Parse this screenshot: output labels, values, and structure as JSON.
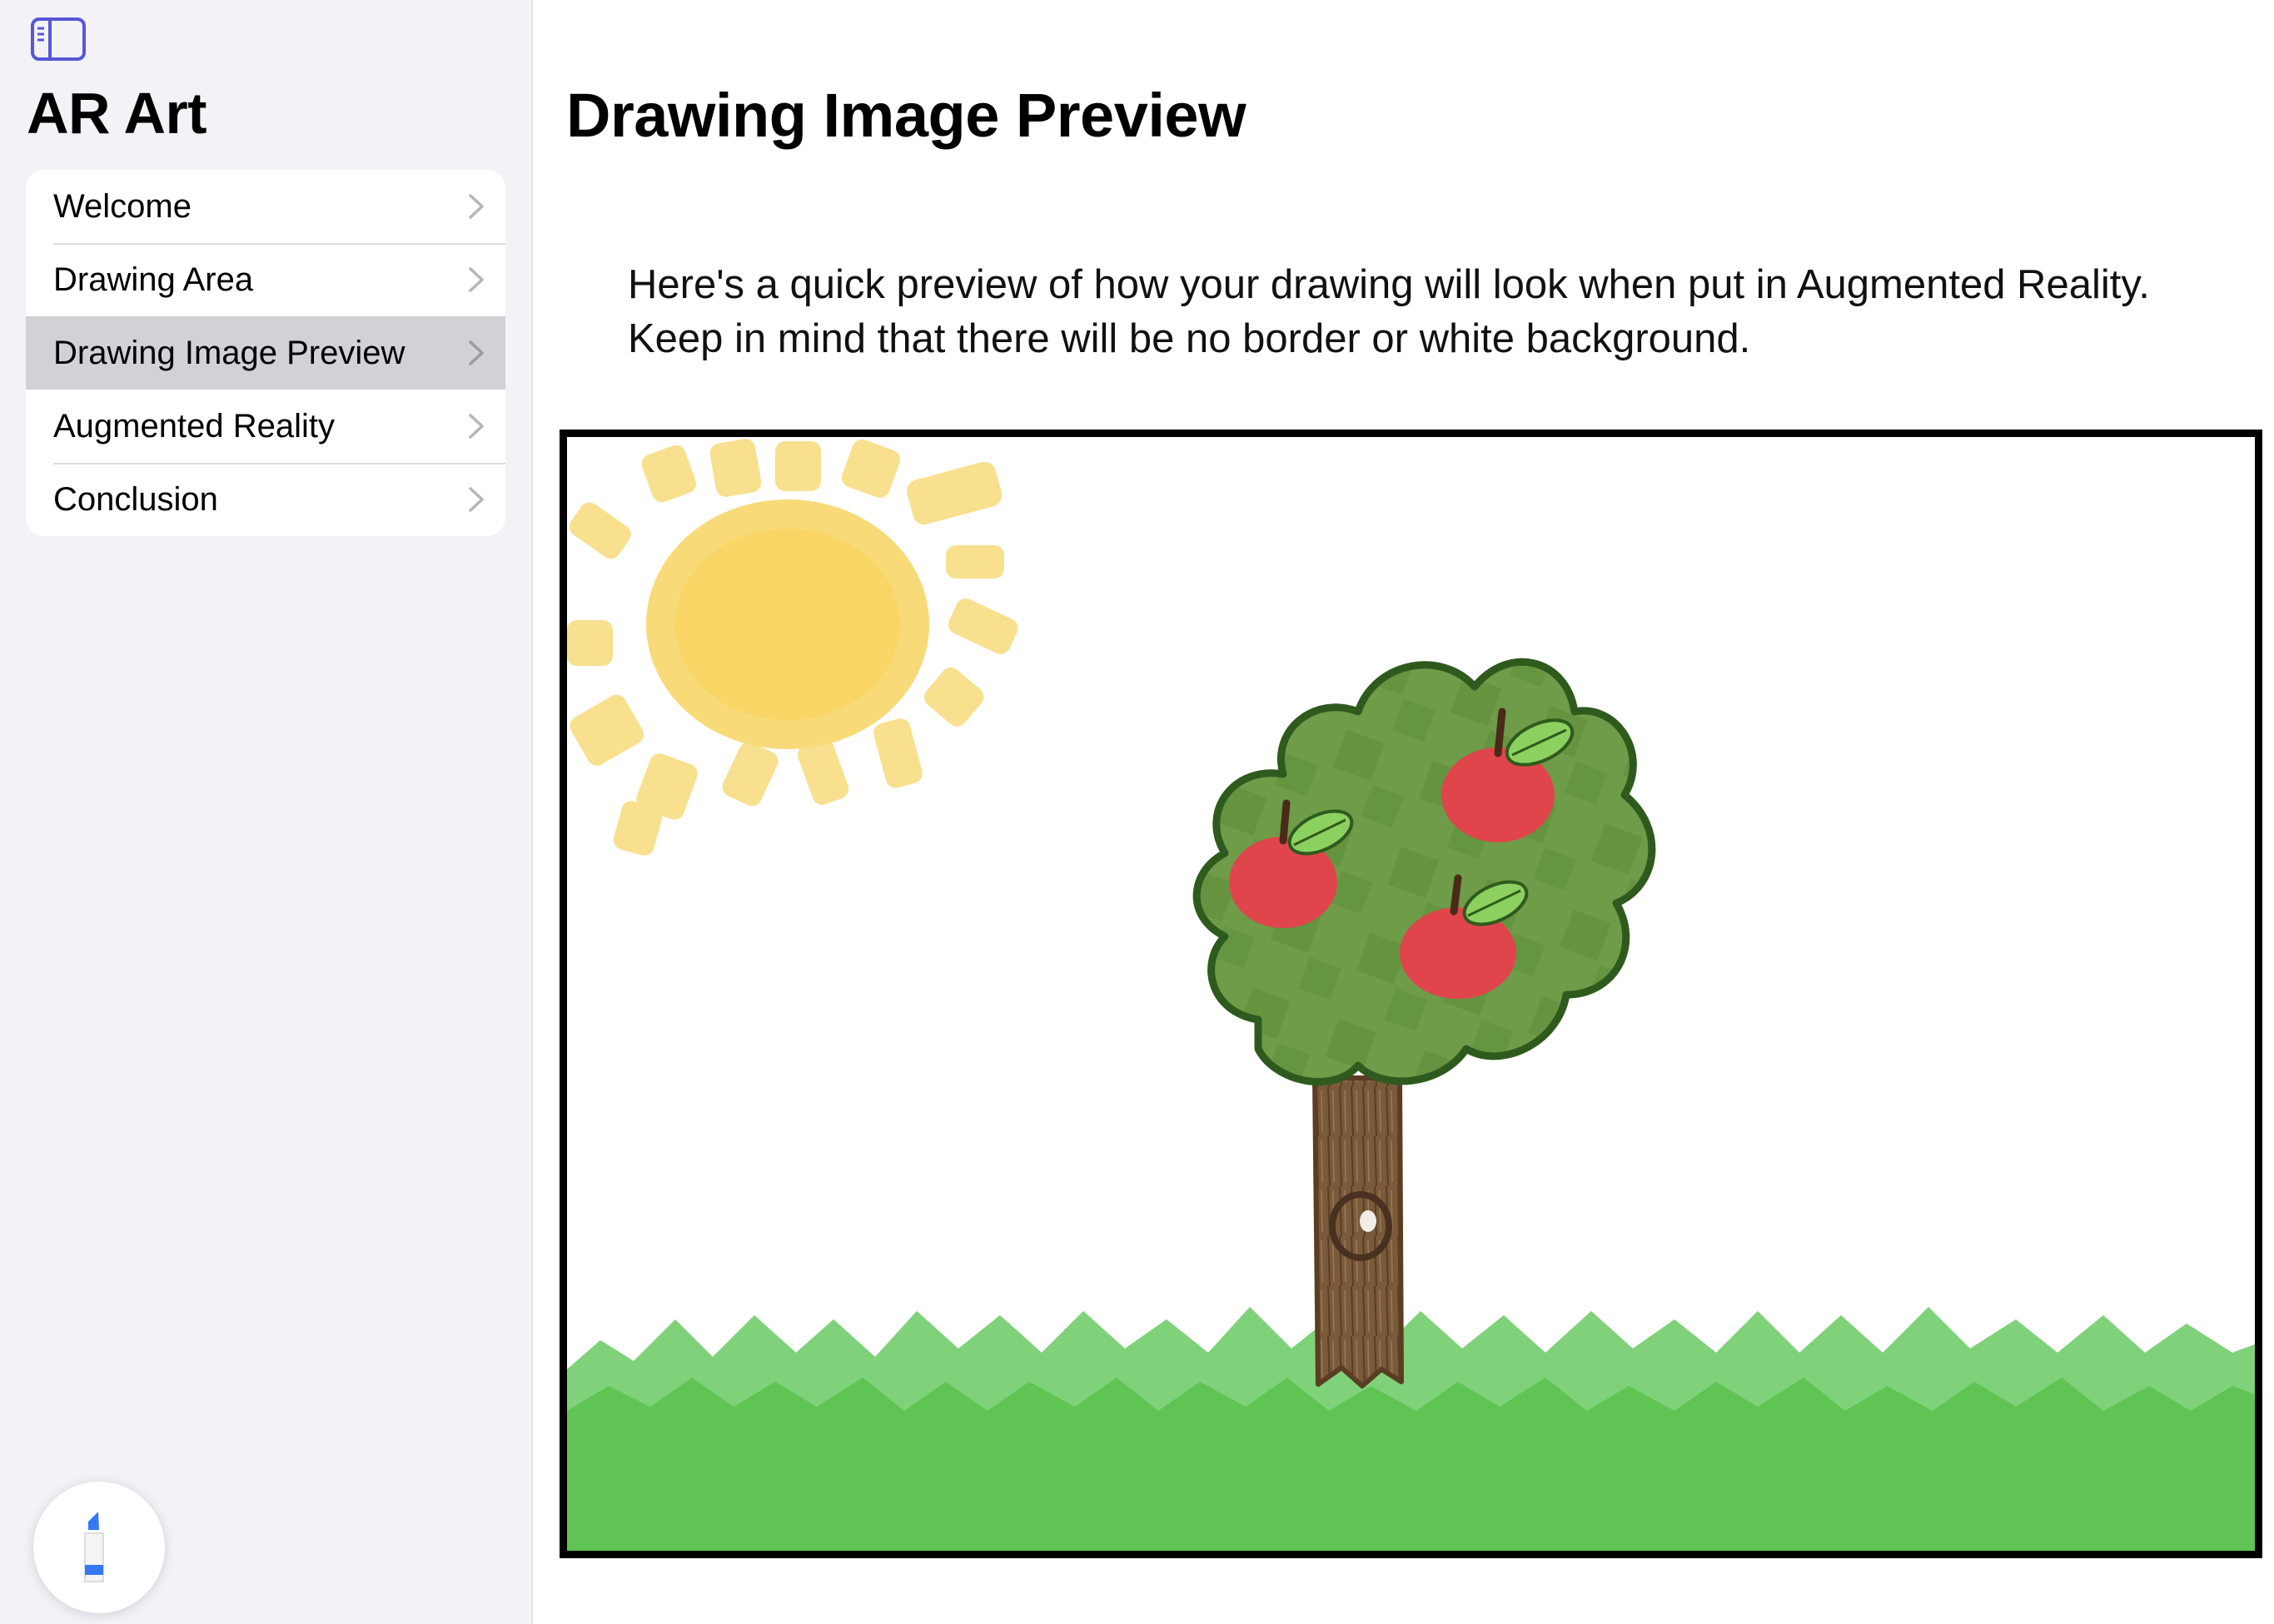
{
  "sidebar": {
    "title": "AR Art",
    "toggle_icon": "sidebar-toggle-icon",
    "items": [
      {
        "label": "Welcome",
        "selected": false
      },
      {
        "label": "Drawing Area",
        "selected": false
      },
      {
        "label": "Drawing Image Preview",
        "selected": true
      },
      {
        "label": "Augmented Reality",
        "selected": false
      },
      {
        "label": "Conclusion",
        "selected": false
      }
    ],
    "tool_icon": "marker-pen-icon"
  },
  "main": {
    "title": "Drawing Image Preview",
    "description_line1": "Here's a quick preview of how your drawing will look when put in Augmented Reality.",
    "description_line2": "Keep in mind that there will be no border or white background.",
    "preview": {
      "content": [
        "sun",
        "apple tree with three apples",
        "grass"
      ]
    }
  },
  "colors": {
    "sidebar_bg": "#f2f2f7",
    "selected_bg": "#d1d1d6",
    "accent": "#5856d6",
    "sun": "#f7d35c",
    "foliage": "#6e9c48",
    "foliage_outline": "#3b6b26",
    "apple": "#e0454b",
    "trunk": "#7a5a3a",
    "grass": "#5fc453"
  }
}
